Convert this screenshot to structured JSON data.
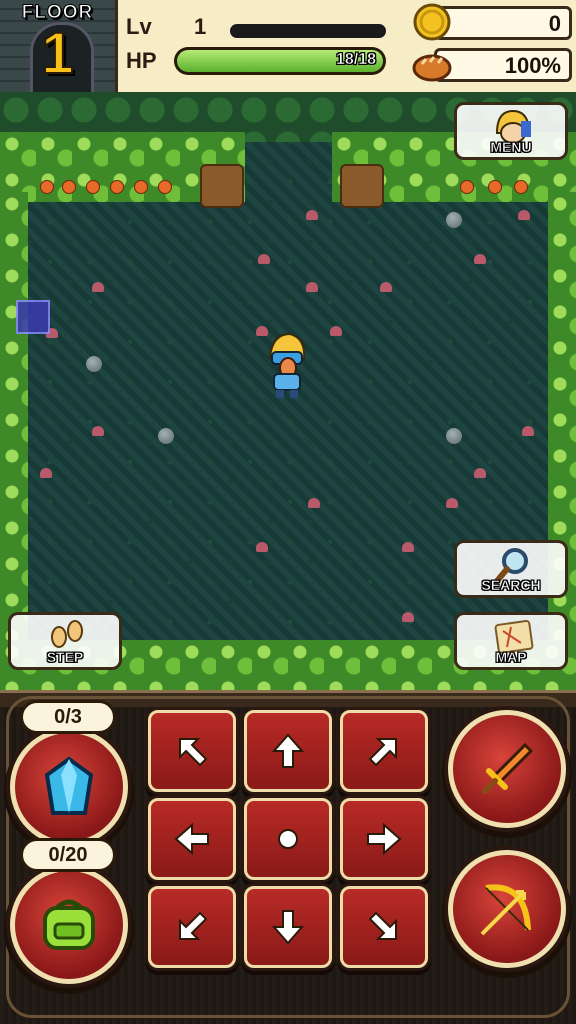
{
  "hud": {
    "floor_label": "FLOOR",
    "floor_number": "1",
    "level_label": "Lv",
    "level_value": "1",
    "hp_label": "HP",
    "hp_text": "18/18",
    "hp_fraction": 1.0,
    "coins": "0",
    "food": "100%"
  },
  "buttons": {
    "menu": "MENU",
    "search": "SEARCH",
    "map": "MAP",
    "step": "STEP"
  },
  "inventory": {
    "crystal_count": "0/3",
    "bag_count": "0/20"
  },
  "icons": {
    "coin": "coin-icon",
    "food": "bread-icon",
    "crystal": "crystal-icon",
    "bag": "backpack-icon",
    "attack": "sword-icon",
    "shoot": "bow-icon"
  },
  "colors": {
    "button_red": "#b82a26",
    "hp_green": "#6fc236",
    "floor_gold": "#f6c21a"
  }
}
